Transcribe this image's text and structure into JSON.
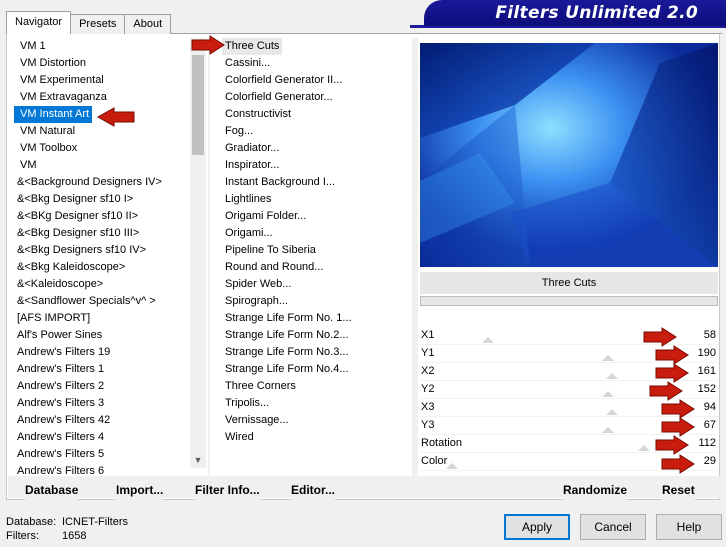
{
  "banner": {
    "title": "Filters Unlimited 2.0"
  },
  "tabs": [
    "Navigator",
    "Presets",
    "About"
  ],
  "categories": [
    "VM 1",
    "VM Distortion",
    "VM Experimental",
    "VM Extravaganza",
    "VM Instant Art",
    "VM Natural",
    "VM Toolbox",
    "VM",
    "&<Background Designers IV>",
    "&<Bkg Designer sf10 I>",
    "&<BKg Designer sf10 II>",
    "&<Bkg Designer sf10 III>",
    "&<Bkg Designers sf10 IV>",
    "&<Bkg Kaleidoscope>",
    "&<Kaleidoscope>",
    "&<Sandflower Specials^v^ >",
    "[AFS IMPORT]",
    "Alf's Power Sines",
    "Andrew's Filters 19",
    "Andrew's Filters 1",
    "Andrew's Filters 2",
    "Andrew's Filters 3",
    "Andrew's Filters 42",
    "Andrew's Filters 4",
    "Andrew's Filters 5",
    "Andrew's Filters 6"
  ],
  "selected_category": "VM Instant Art",
  "filters": [
    "Three Cuts",
    "Cassini...",
    "Colorfield Generator II...",
    "Colorfield Generator...",
    "Constructivist",
    "Fog...",
    "Gradiator...",
    "Inspirator...",
    "Instant Background I...",
    "Lightlines",
    "Origami Folder...",
    "Origami...",
    "Pipeline To Siberia",
    "Round and Round...",
    "Spider Web...",
    "Spirograph...",
    "Strange Life Form No. 1...",
    "Strange Life Form No.2...",
    "Strange Life Form No.3...",
    "Strange Life Form No.4...",
    "Three Corners",
    "Tripolis...",
    "Vernissage...",
    "Wired"
  ],
  "selected_filter": "Three Cuts",
  "preview": {
    "filter_name": "Three Cuts"
  },
  "params": [
    {
      "label": "X1",
      "value": "58"
    },
    {
      "label": "Y1",
      "value": "190"
    },
    {
      "label": "X2",
      "value": "161"
    },
    {
      "label": "Y2",
      "value": "152"
    },
    {
      "label": "X3",
      "value": "94"
    },
    {
      "label": "Y3",
      "value": "67"
    },
    {
      "label": "Rotation",
      "value": "112"
    },
    {
      "label": "Color",
      "value": "29"
    }
  ],
  "bottom_buttons": {
    "database": "Database",
    "import": "Import...",
    "filter_info": "Filter Info...",
    "editor": "Editor...",
    "randomize": "Randomize",
    "reset": "Reset"
  },
  "info": {
    "database_label": "Database:",
    "database_value": "ICNET-Filters",
    "filters_label": "Filters:",
    "filters_value": "1658"
  },
  "dialog_buttons": {
    "apply": "Apply",
    "cancel": "Cancel",
    "help": "Help"
  },
  "colors": {
    "selection": "#0078d7",
    "banner": "#1a1a9a",
    "arrow": "#c81c0c"
  }
}
